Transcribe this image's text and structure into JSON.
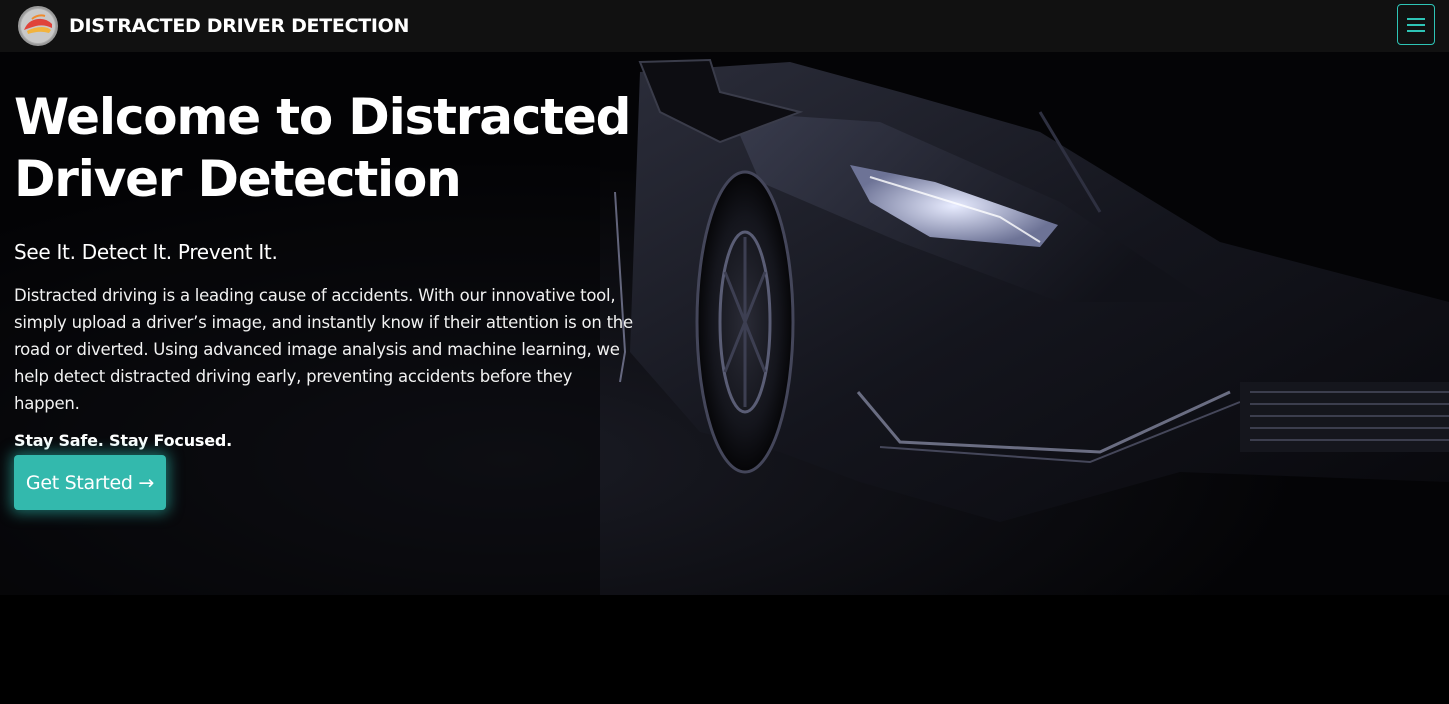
{
  "navbar": {
    "brand": "DISTRACTED DRIVER DETECTION",
    "logo_icon": "car-logo-icon",
    "menu_icon": "hamburger-menu-icon"
  },
  "hero": {
    "title": "Welcome to Distracted Driver Detection",
    "subtitle": "See It. Detect It. Prevent It.",
    "description": "Distracted driving is a leading cause of accidents. With our innovative tool, simply upload a driver’s image, and instantly know if their attention is on the road or diverted. Using advanced image analysis and machine learning, we help detect distracted driving early, preventing accidents before they happen.",
    "tagline": "Stay Safe. Stay Focused.",
    "cta_label": "Get Started →",
    "background_image": "dark-sports-car-image"
  },
  "colors": {
    "accent": "#2ec4b6",
    "button": "#33b9ad",
    "navbar": "#111111",
    "background": "#000000"
  }
}
